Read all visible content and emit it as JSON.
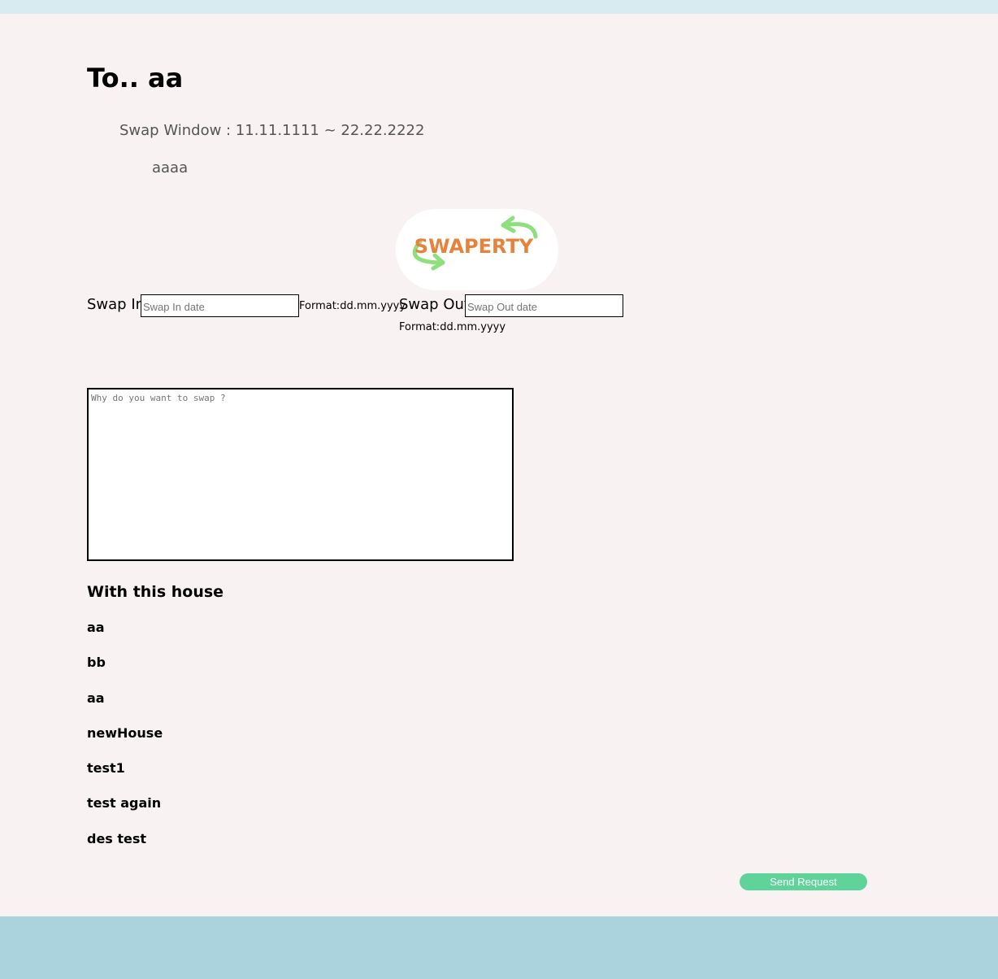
{
  "header": {
    "title": "To.. aa",
    "swap_window": "Swap Window : 11.11.1111 ~ 22.22.2222",
    "description": "aaaa"
  },
  "logo": {
    "text": "SWAPERTY",
    "text_color": "#e8823a",
    "arrow_color": "#8ee07e"
  },
  "form": {
    "swap_in_label": "Swap In",
    "swap_in_placeholder": "Swap In date",
    "swap_in_hint": "Format:dd.mm.yyyy",
    "swap_out_label": "Swap Out",
    "swap_out_placeholder": "Swap Out date",
    "swap_out_hint": "Format:dd.mm.yyyy",
    "reason_placeholder": "Why do you want to swap ?"
  },
  "houses": {
    "heading": "With this house",
    "items": [
      "aa",
      "bb",
      "aa",
      "newHouse",
      "test1",
      "test again",
      "des test"
    ]
  },
  "actions": {
    "send_label": "Send Request",
    "send_color": "#5fd39a"
  },
  "footer": {
    "bg_color": "#aad3dd"
  }
}
